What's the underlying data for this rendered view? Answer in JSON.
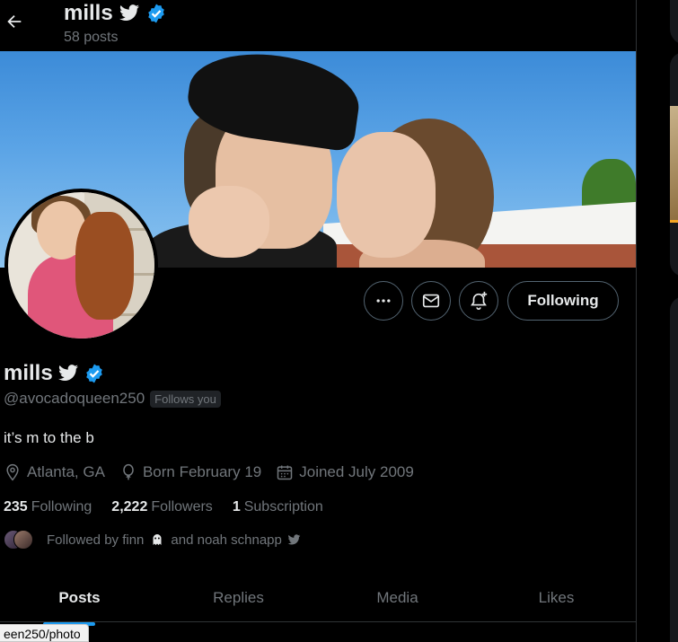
{
  "header": {
    "name": "mills",
    "posts_count": "58 posts"
  },
  "profile": {
    "display_name": "mills",
    "handle": "@avocadoqueen250",
    "follows_you_badge": "Follows you",
    "bio": "it’s m to the b",
    "location": "Atlanta, GA",
    "birthday": "Born February 19",
    "joined": "Joined July 2009",
    "verified_color": "#1d9bf0"
  },
  "actions": {
    "more_icon": "more-icon",
    "message_icon": "mail-icon",
    "notify_icon": "bell-plus-icon",
    "following_label": "Following"
  },
  "stats": {
    "following_count": "235",
    "following_label": "Following",
    "followers_count": "2,222",
    "followers_label": "Followers",
    "subscription_count": "1",
    "subscription_label": "Subscription"
  },
  "followed_by": {
    "prefix": "Followed by finn",
    "middle": "and noah schnapp"
  },
  "tabs": [
    {
      "label": "Posts",
      "active": true
    },
    {
      "label": "Replies",
      "active": false
    },
    {
      "label": "Media",
      "active": false
    },
    {
      "label": "Likes",
      "active": false
    }
  ],
  "status_bar": {
    "url": "een250/photo"
  },
  "colors": {
    "background": "#000000",
    "text_primary": "#e7e9ea",
    "text_secondary": "#71767b",
    "accent": "#1d9bf0",
    "border": "#536471"
  }
}
